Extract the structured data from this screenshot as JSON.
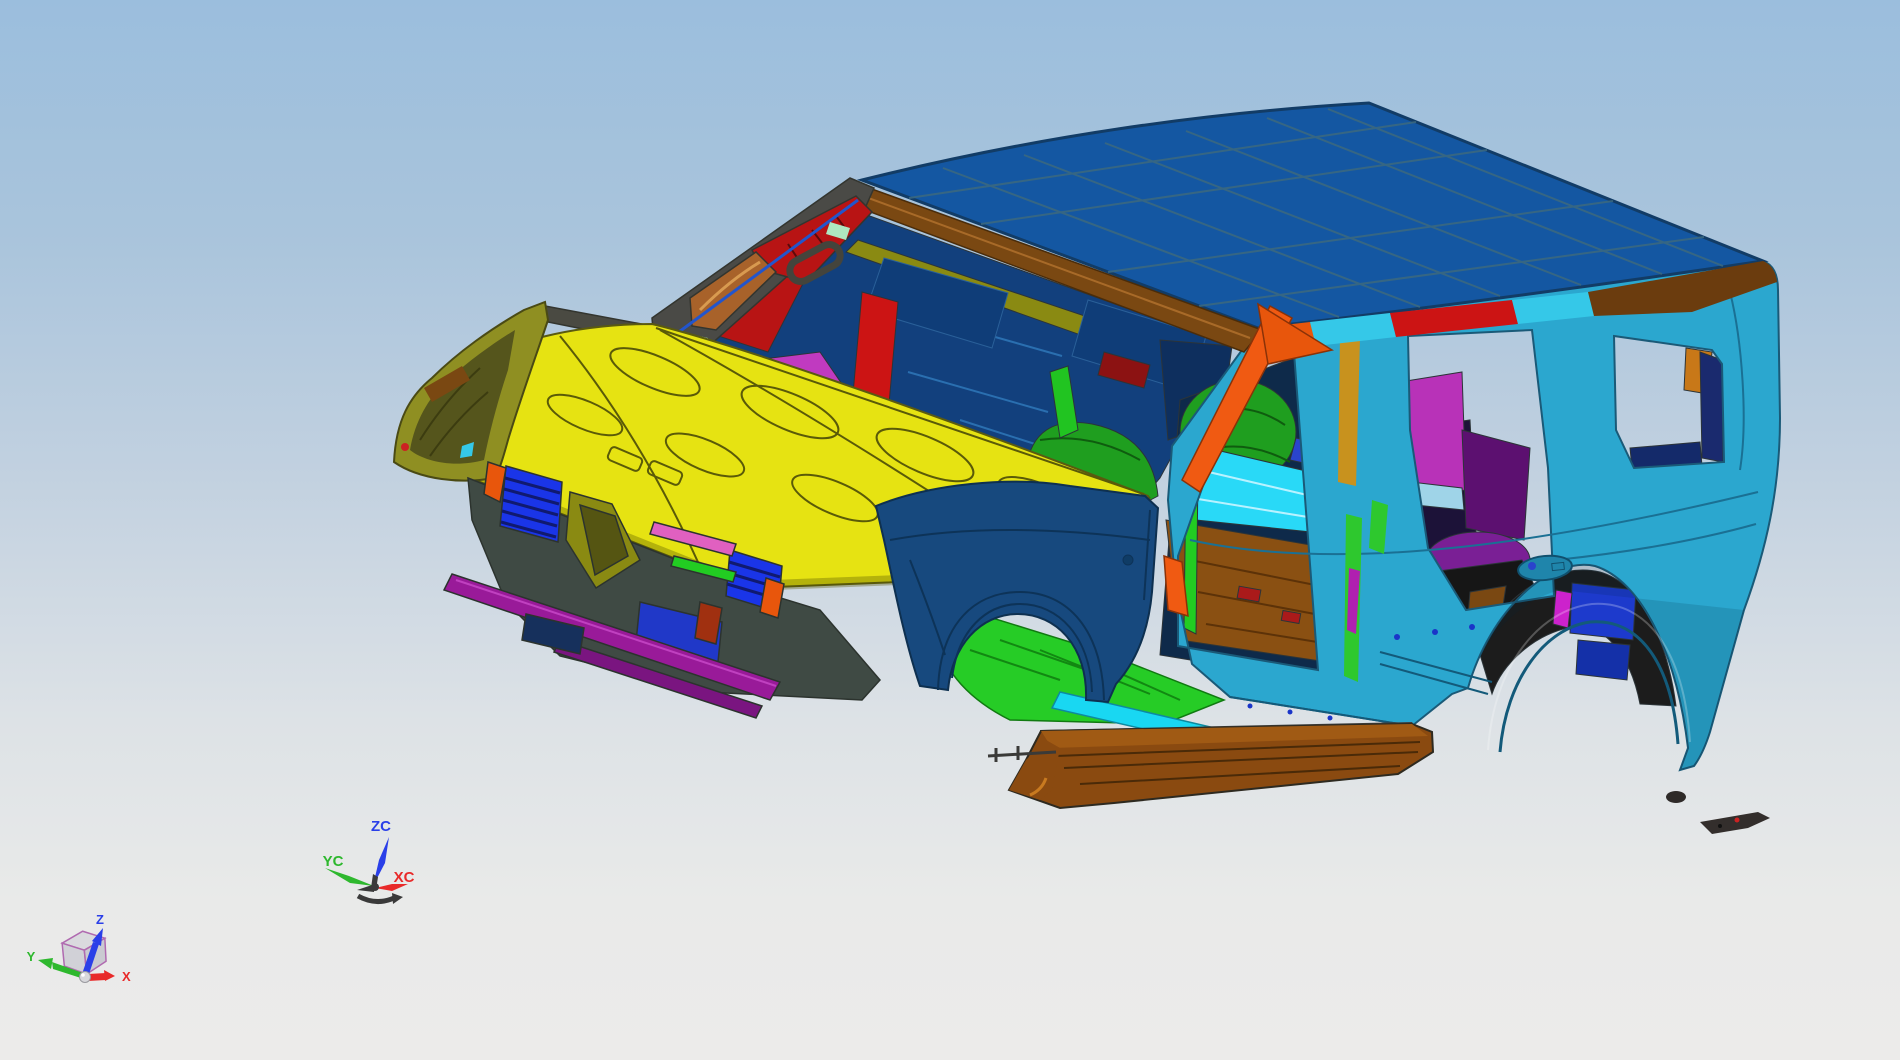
{
  "viewport": {
    "name": "cad-3d-viewport",
    "background_top": "#9bbedd",
    "background_bottom": "#ecebea"
  },
  "model": {
    "description": "SUV body-in-white sheet-metal assembly, front three-quarter view",
    "colors": {
      "roof": "#1457a2",
      "hood": "#e6e312",
      "body_side": "#2ba7cf",
      "front_fender": "#17497e",
      "left_fender": "#8f8f22",
      "roof_rail_brown": "#7a4812",
      "rocker_sill": "#8a4a10",
      "floor_green": "#26cc26",
      "floor_brown": "#8a5012",
      "floor_cyan": "#29d9f7",
      "sill_cyan": "#19d7f2",
      "pillar_orange": "#f05a12",
      "pillar_red": "#b81414",
      "cowl_magenta": "#a12fa1",
      "trim_purple": "#5c1070",
      "dash_blue": "#12407d",
      "grille_blue": "#1a35e8",
      "bumper_magenta": "#991a99",
      "seat_green": "#1f9e1f",
      "belt_rail_tan": "#c8921e",
      "wheelhouse_blue": "#1d3acc",
      "edge_gray": "#44484a"
    }
  },
  "wcs_triad": {
    "name": "work-coordinate-system",
    "z_axis": {
      "label": "ZC",
      "color": "#2a3fe8"
    },
    "y_axis": {
      "label": "YC",
      "color": "#2eb82e"
    },
    "x_axis": {
      "label": "XC",
      "color": "#e82a2a"
    },
    "handle_color": "#3a3a3a"
  },
  "view_triad": {
    "name": "datum-csys-indicator",
    "z_axis": {
      "label": "Z",
      "color": "#2a3fe8"
    },
    "y_axis": {
      "label": "Y",
      "color": "#2eb82e"
    },
    "x_axis": {
      "label": "X",
      "color": "#e82a2a"
    },
    "cube_edge_color": "#b06ab0",
    "origin_color": "#d8d8dc"
  }
}
